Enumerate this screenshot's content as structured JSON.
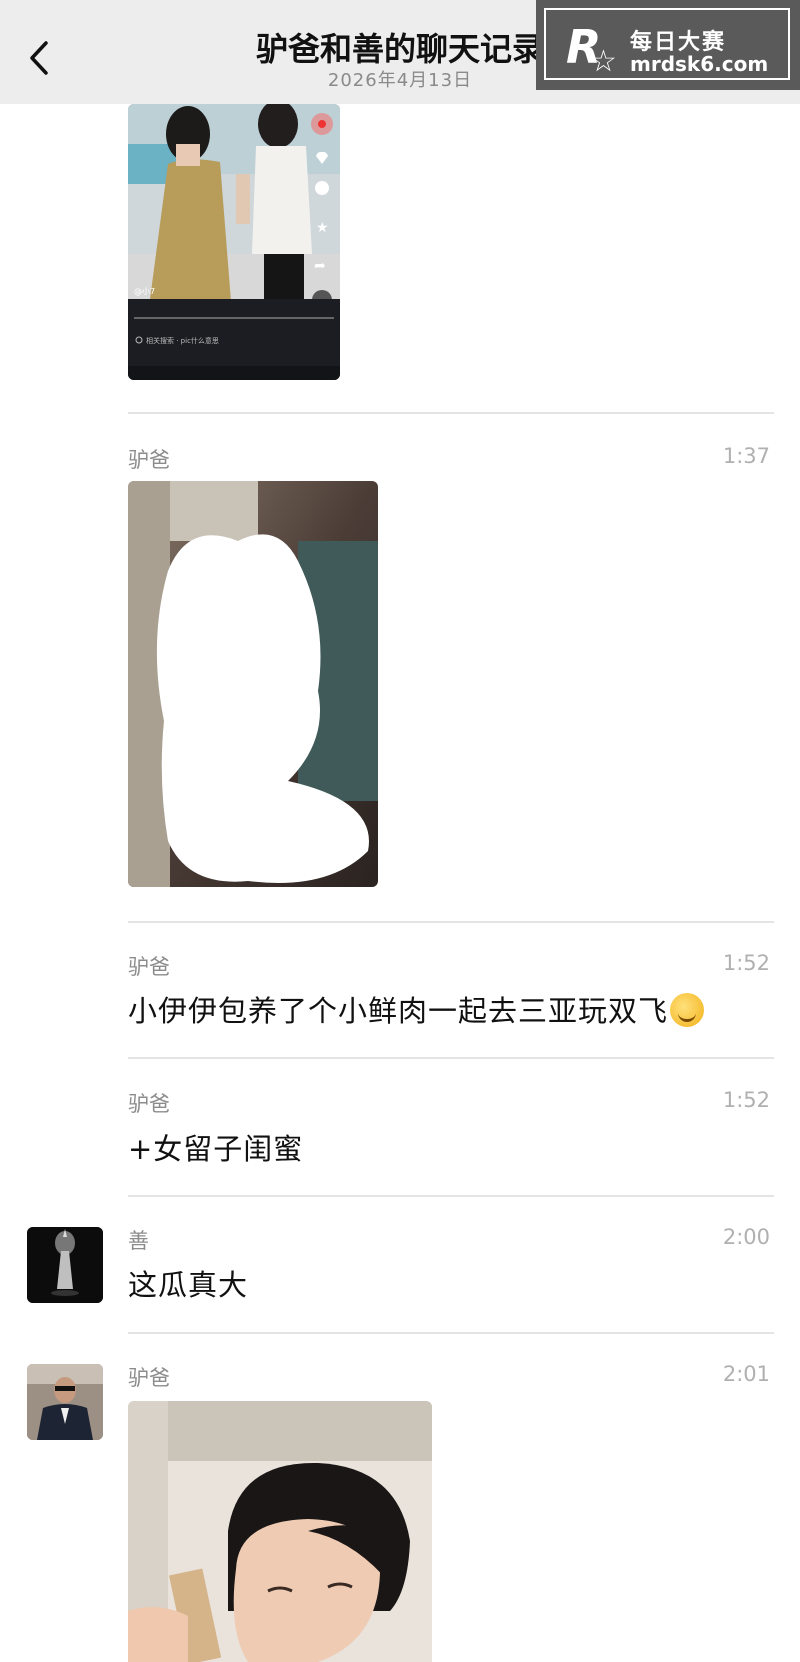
{
  "header": {
    "title": "驴爸和善的聊天记录",
    "subtitle": "2026年4月13日"
  },
  "watermark": {
    "line1": "每日大赛",
    "line2": "mrdsk6.com"
  },
  "top_image": {
    "caption_user": "@小7",
    "search_text": "相关搜索 · pic什么意思"
  },
  "messages": [
    {
      "sender": "驴爸",
      "time": "1:37"
    },
    {
      "sender": "驴爸",
      "time": "1:52",
      "text": "小伊伊包养了个小鲜肉一起去三亚玩双飞"
    },
    {
      "sender": "驴爸",
      "time": "1:52",
      "text": "+女留子闺蜜"
    },
    {
      "sender": "善",
      "time": "2:00",
      "text": "这瓜真大"
    },
    {
      "sender": "驴爸",
      "time": "2:01"
    }
  ],
  "colors": {
    "header_bg": "#ededed",
    "divider": "#e4e4e4",
    "sender": "#8c8c8c",
    "time": "#b0b0b0"
  }
}
